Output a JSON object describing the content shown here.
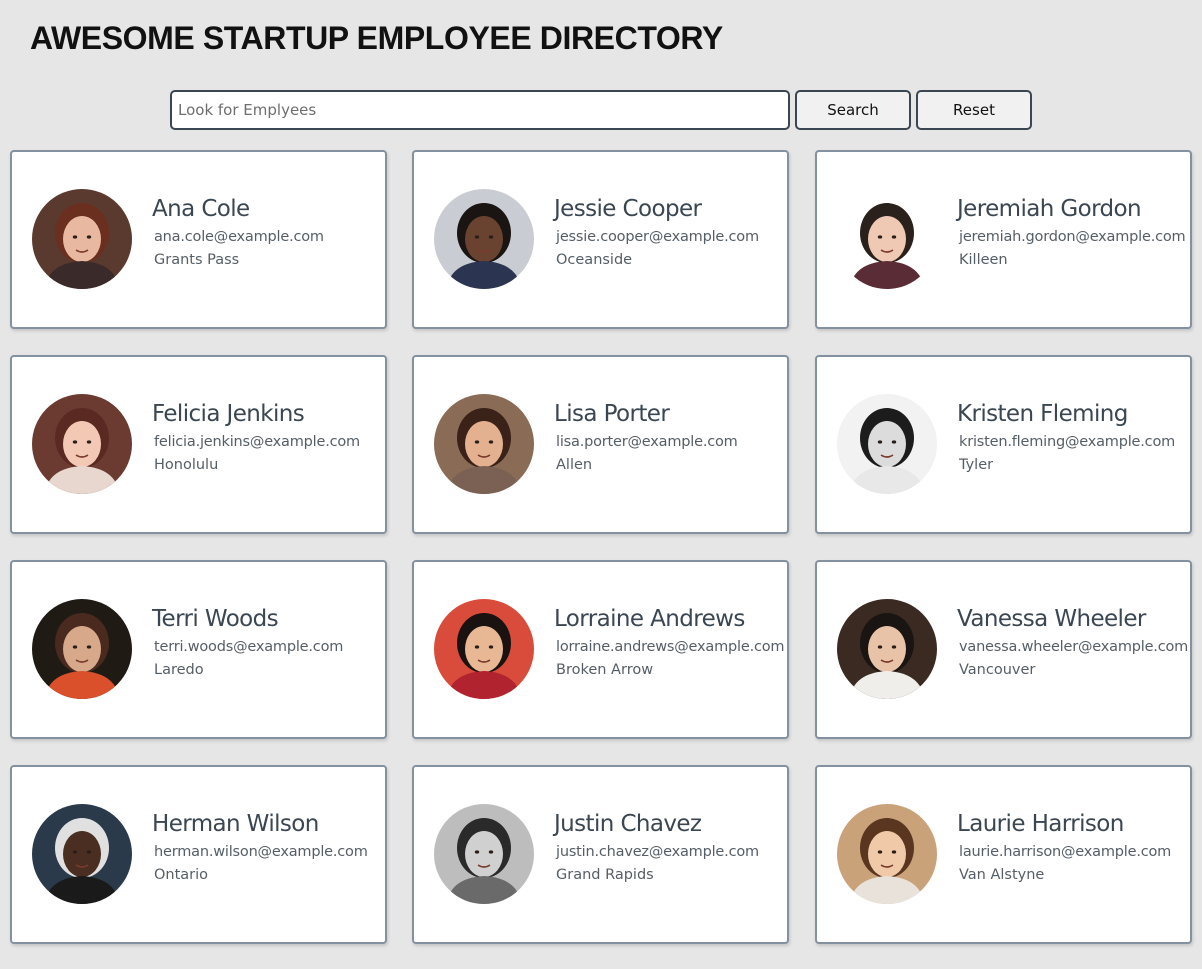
{
  "header": {
    "title": "AWESOME STARTUP EMPLOYEE DIRECTORY"
  },
  "search": {
    "placeholder": "Look for Emplyees",
    "value": "",
    "search_label": "Search",
    "reset_label": "Reset"
  },
  "employees": [
    {
      "name": "Ana Cole",
      "email": "ana.cole@example.com",
      "city": "Grants Pass",
      "bg": "#5a3a2e",
      "skin": "#e8b9a0",
      "hair": "#6b2f1f",
      "shirt": "#3a2a2a"
    },
    {
      "name": "Jessie Cooper",
      "email": "jessie.cooper@example.com",
      "city": "Oceanside",
      "bg": "#c9ccd2",
      "skin": "#6a4330",
      "hair": "#1a1412",
      "shirt": "#2b3552"
    },
    {
      "name": "Jeremiah Gordon",
      "email": "jeremiah.gordon@example.com",
      "city": "Killeen",
      "bg": "#ffffff",
      "skin": "#f0c9b4",
      "hair": "#2a211c",
      "shirt": "#5a2c36"
    },
    {
      "name": "Felicia Jenkins",
      "email": "felicia.jenkins@example.com",
      "city": "Honolulu",
      "bg": "#6b3a30",
      "skin": "#f3c9b6",
      "hair": "#5a2a22",
      "shirt": "#e7d7cf"
    },
    {
      "name": "Lisa Porter",
      "email": "lisa.porter@example.com",
      "city": "Allen",
      "bg": "#8a6b56",
      "skin": "#e3b190",
      "hair": "#3a2219",
      "shirt": "#7b6154"
    },
    {
      "name": "Kristen Fleming",
      "email": "kristen.fleming@example.com",
      "city": "Tyler",
      "bg": "#f2f2f2",
      "skin": "#dcdcdc",
      "hair": "#1c1c1c",
      "shirt": "#e8e8e8"
    },
    {
      "name": "Terri Woods",
      "email": "terri.woods@example.com",
      "city": "Laredo",
      "bg": "#1f1a14",
      "skin": "#d8a88a",
      "hair": "#4a2a1e",
      "shirt": "#d9502a"
    },
    {
      "name": "Lorraine Andrews",
      "email": "lorraine.andrews@example.com",
      "city": "Broken Arrow",
      "bg": "#d94b3a",
      "skin": "#e8b894",
      "hair": "#1a1210",
      "shirt": "#b1232e"
    },
    {
      "name": "Vanessa Wheeler",
      "email": "vanessa.wheeler@example.com",
      "city": "Vancouver",
      "bg": "#3a2a22",
      "skin": "#e9c3a8",
      "hair": "#1a1412",
      "shirt": "#f0eeea"
    },
    {
      "name": "Herman Wilson",
      "email": "herman.wilson@example.com",
      "city": "Ontario",
      "bg": "#2a3a4a",
      "skin": "#4a2e22",
      "hair": "#e0e0e0",
      "shirt": "#1a1a1a"
    },
    {
      "name": "Justin Chavez",
      "email": "justin.chavez@example.com",
      "city": "Grand Rapids",
      "bg": "#bdbdbd",
      "skin": "#d0d0d0",
      "hair": "#2a2a2a",
      "shirt": "#6a6a6a"
    },
    {
      "name": "Laurie Harrison",
      "email": "laurie.harrison@example.com",
      "city": "Van Alstyne",
      "bg": "#c9a27a",
      "skin": "#f0caa8",
      "hair": "#5a3620",
      "shirt": "#e8e2da"
    }
  ]
}
